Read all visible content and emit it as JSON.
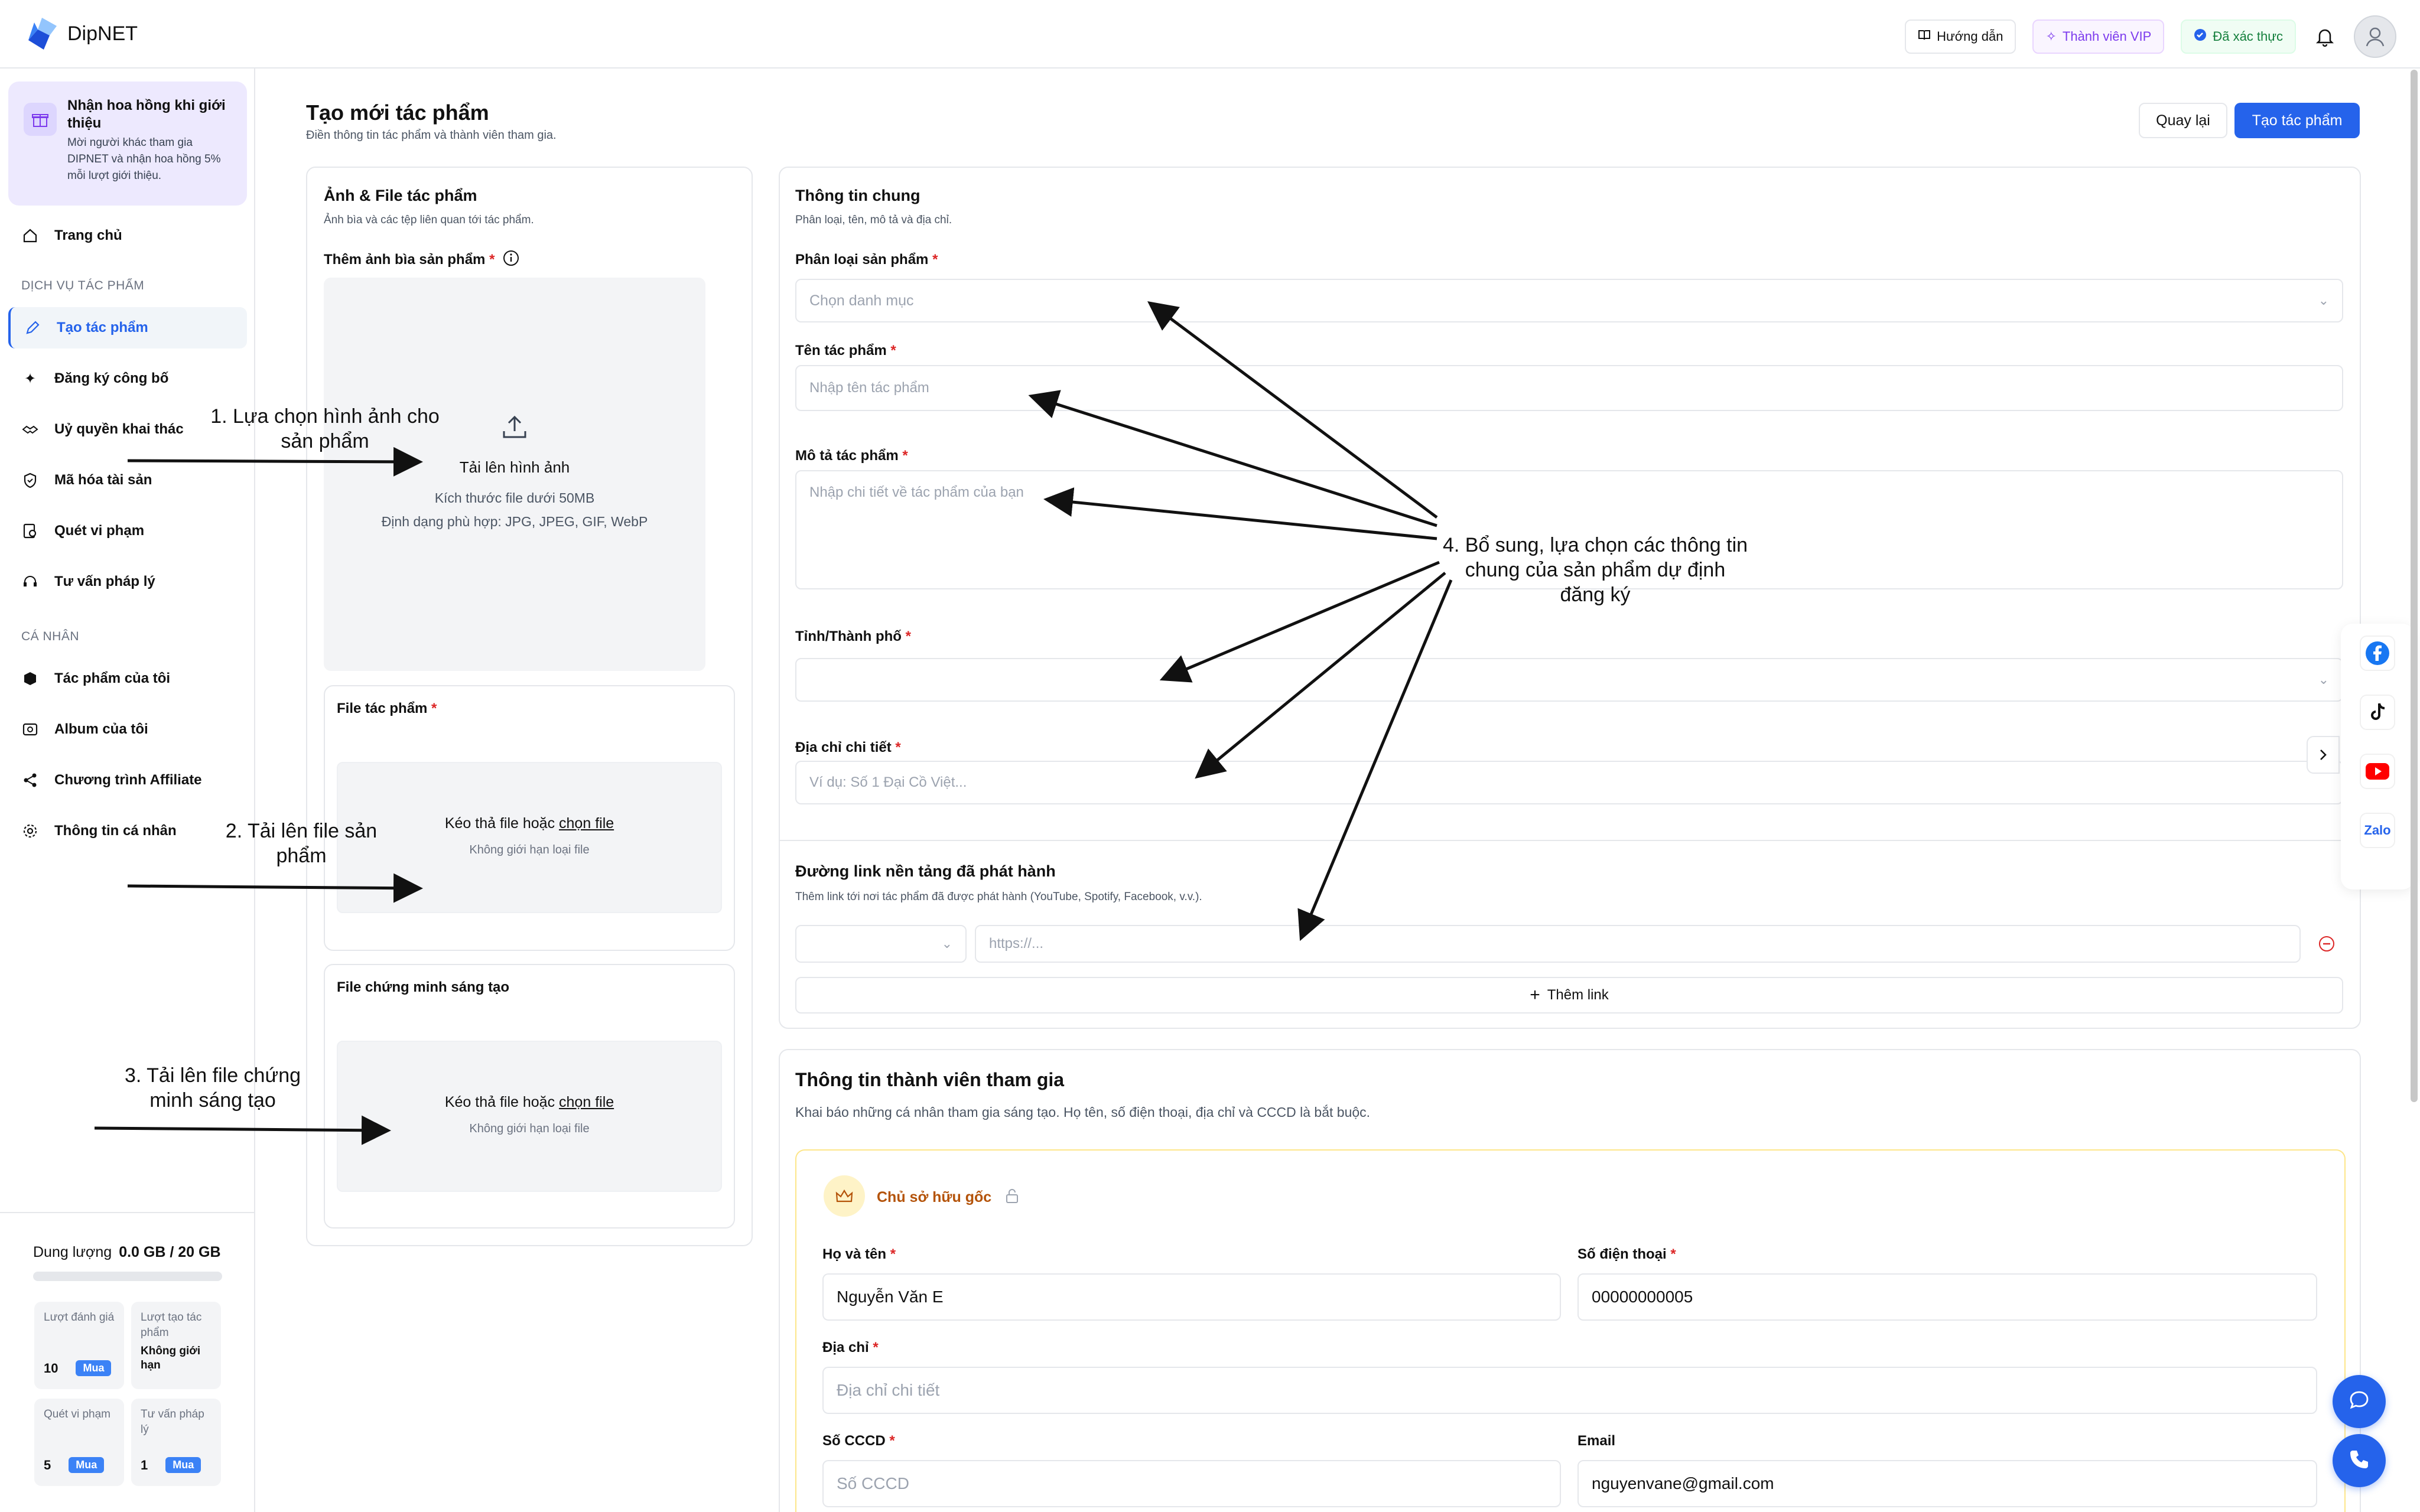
{
  "app": {
    "name": "DipNET",
    "brand_color": "#2563eb"
  },
  "topbar": {
    "guide_label": "Hướng dẫn",
    "vip_label": "Thành viên VIP",
    "verified_label": "Đã xác thực",
    "icons": [
      "book-icon",
      "sparkle-icon",
      "verified-icon",
      "bell-icon",
      "user-avatar-icon"
    ]
  },
  "sidebar": {
    "promo": {
      "title": "Nhận hoa hồng khi giới thiệu",
      "text": "Mời người khác tham gia DIPNET và nhận hoa hồng 5% mỗi lượt giới thiệu."
    },
    "home": "Trang chủ",
    "section_services": "DỊCH VỤ TÁC PHẨM",
    "services": [
      {
        "label": "Tạo tác phẩm",
        "icon": "pencil-icon",
        "active": true
      },
      {
        "label": "Đăng ký công bố",
        "icon": "sparkle-icon",
        "active": false
      },
      {
        "label": "Uỷ quyền khai thác",
        "icon": "handshake-icon",
        "active": false
      },
      {
        "label": "Mã hóa tài sản",
        "icon": "shield-icon",
        "active": false
      },
      {
        "label": "Quét vi phạm",
        "icon": "scan-icon",
        "active": false
      },
      {
        "label": "Tư vấn pháp lý",
        "icon": "headset-icon",
        "active": false
      }
    ],
    "section_personal": "CÁ NHÂN",
    "personal": [
      {
        "label": "Tác phẩm của tôi",
        "icon": "box-icon"
      },
      {
        "label": "Album của tôi",
        "icon": "album-icon"
      },
      {
        "label": "Chương trình Affiliate",
        "icon": "share-icon"
      },
      {
        "label": "Thông tin cá nhân",
        "icon": "gear-icon"
      }
    ],
    "storage": {
      "label": "Dung lượng",
      "value": "0.0 GB / 20 GB",
      "used_fraction": 0.0
    },
    "quotas": [
      {
        "label": "Lượt đánh giá",
        "value": "10",
        "buy": "Mua"
      },
      {
        "label": "Lượt tạo tác phẩm",
        "value": "Không giới hạn",
        "buy": ""
      },
      {
        "label": "Quét vi phạm",
        "value": "5",
        "buy": "Mua"
      },
      {
        "label": "Tư vấn pháp lý",
        "value": "1",
        "buy": "Mua"
      }
    ]
  },
  "page": {
    "title": "Tạo mới tác phẩm",
    "subtitle": "Điền thông tin tác phẩm và thành viên tham gia.",
    "back_label": "Quay lại",
    "create_label": "Tạo tác phẩm"
  },
  "files_card": {
    "title": "Ảnh & File tác phẩm",
    "subtitle": "Ảnh bìa và các tệp liên quan tới tác phẩm.",
    "cover_label": "Thêm ảnh bìa sản phẩm",
    "upload_title": "Tải lên hình ảnh",
    "upload_size": "Kích thước file dưới 50MB",
    "upload_formats": "Định dạng phù hợp: JPG, JPEG, GIF, WebP",
    "work_file_label": "File tác phẩm",
    "proof_file_label": "File chứng minh sáng tạo",
    "drop_text_before": "Kéo thả file hoặc ",
    "drop_link": "chọn file",
    "drop_hint": "Không giới hạn loại file"
  },
  "general_card": {
    "title": "Thông tin chung",
    "subtitle": "Phân loại, tên, mô tả và địa chỉ.",
    "category_label": "Phân loại sản phẩm",
    "category_placeholder": "Chọn danh mục",
    "name_label": "Tên tác phẩm",
    "name_placeholder": "Nhập tên tác phẩm",
    "desc_label": "Mô tả tác phẩm",
    "desc_placeholder": "Nhập chi tiết về tác phẩm của bạn",
    "province_label": "Tỉnh/Thành phố",
    "province_value": "",
    "address_label": "Địa chỉ chi tiết",
    "address_placeholder": "Ví dụ: Số 1 Đại Cồ Việt...",
    "links_title": "Đường link nền tảng đã phát hành",
    "links_subtitle": "Thêm link tới nơi tác phẩm đã được phát hành (YouTube, Spotify, Facebook, v.v.).",
    "link_platform_value": "",
    "link_url_placeholder": "https://...",
    "add_link_label": "Thêm link"
  },
  "members_card": {
    "title": "Thông tin thành viên tham gia",
    "subtitle": "Khai báo những cá nhân tham gia sáng tạo. Họ tên, số điện thoại, địa chỉ và CCCD là bắt buộc.",
    "owner_label": "Chủ sở hữu gốc",
    "fullname_label": "Họ và tên",
    "fullname_value": "Nguyễn Văn E",
    "phone_label": "Số điện thoại",
    "phone_value": "00000000005",
    "address_label": "Địa chỉ",
    "address_placeholder": "Địa chỉ chi tiết",
    "cccd_label": "Số CCCD",
    "cccd_placeholder": "Số CCCD",
    "email_label": "Email",
    "email_value": "nguyenvane@gmail.com"
  },
  "required_mark": "*",
  "annotations": [
    "1. Lựa chọn hình ảnh cho sản phẩm",
    "2. Tải lên file sản phẩm",
    "3. Tải lên file chứng minh sáng tạo",
    "4. Bổ sung, lựa chọn các thông tin chung của sản phẩm dự định đăng ký"
  ],
  "social": {
    "zalo_label": "Zalo",
    "icons": [
      "facebook-icon",
      "tiktok-icon",
      "youtube-icon",
      "zalo-icon"
    ]
  }
}
